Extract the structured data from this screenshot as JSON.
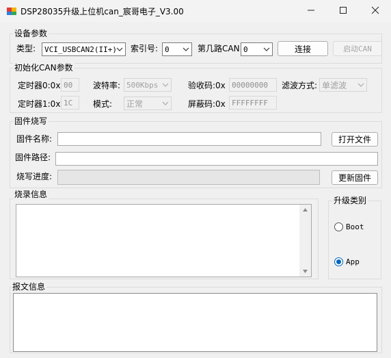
{
  "window": {
    "title": "DSP28035升级上位机can_宸哥电子_V3.00",
    "minimize_icon": "minimize-icon",
    "maximize_icon": "maximize-icon",
    "close_icon": "close-icon"
  },
  "device": {
    "legend": "设备参数",
    "type_label": "类型:",
    "type_value": "VCI_USBCAN2(II+)",
    "index_label": "索引号:",
    "index_value": "0",
    "channel_label": "第几路CAN:",
    "channel_value": "0",
    "connect_label": "连接",
    "start_can_label": "启动CAN"
  },
  "init_can": {
    "legend": "初始化CAN参数",
    "timer0_label": "定时器0:0x",
    "timer0_value": "00",
    "baud_label": "波特率:",
    "baud_value": "500Kbps",
    "acc_code_label": "验收码:0x",
    "acc_code_value": "00000000",
    "filter_label": "滤波方式:",
    "filter_value": "单滤波",
    "timer1_label": "定时器1:0x",
    "timer1_value": "1C",
    "mode_label": "模式:",
    "mode_value": "正常",
    "mask_label": "屏蔽码:0x",
    "mask_value": "FFFFFFFF"
  },
  "firmware": {
    "legend": "固件烧写",
    "name_label": "固件名称:",
    "name_value": "",
    "open_file_label": "打开文件",
    "path_label": "固件路径:",
    "path_value": "",
    "progress_label": "烧写进度:",
    "progress_value": 0,
    "update_label": "更新固件"
  },
  "burn_log": {
    "legend": "烧录信息",
    "content": ""
  },
  "upgrade_type": {
    "legend": "升级类别",
    "options": [
      {
        "label": "Boot",
        "checked": false
      },
      {
        "label": "App",
        "checked": true
      }
    ]
  },
  "message": {
    "legend": "报文信息",
    "content": ""
  },
  "colors": {
    "accent": "#0067c0",
    "border": "#dcdcdc"
  }
}
